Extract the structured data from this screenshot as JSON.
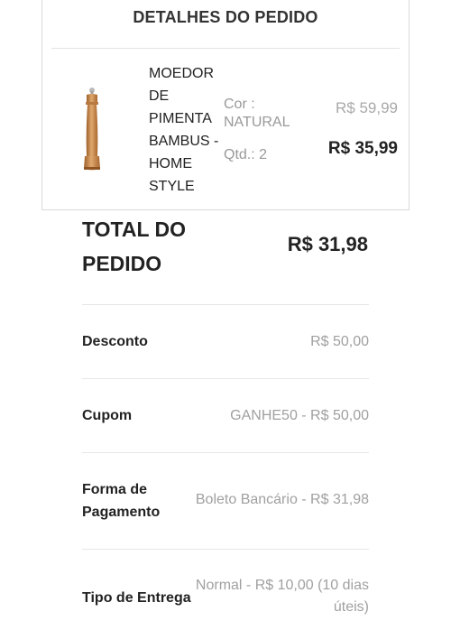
{
  "order_details": {
    "title": "DETALHES DO PEDIDO",
    "product": {
      "name": "MOEDOR DE PIMENTA BAMBUS - HOME STYLE",
      "thumbnail_icon": "wooden-pepper-grinder",
      "color_label": "Cor :",
      "color_value": "NATURAL",
      "quantity": "Qtd.: 2",
      "original_price": "R$ 59,99",
      "price": "R$ 35,99"
    }
  },
  "summary": {
    "total_label": "TOTAL DO PEDIDO",
    "total_value": "R$ 31,98",
    "rows": [
      {
        "label": "Desconto",
        "value": "R$ 50,00"
      },
      {
        "label": "Cupom",
        "value": "GANHE50 - R$ 50,00"
      },
      {
        "label": "Forma de Pagamento",
        "value": "Boleto Bancário - R$ 31,98"
      },
      {
        "label": "Tipo de Entrega",
        "value": "Normal - R$ 10,00 (10 dias úteis)"
      }
    ]
  },
  "colors": {
    "text_primary": "#222222",
    "text_muted": "#a0a0a0",
    "divider": "#e6e6e6",
    "product_wood": "#c98a4a"
  }
}
